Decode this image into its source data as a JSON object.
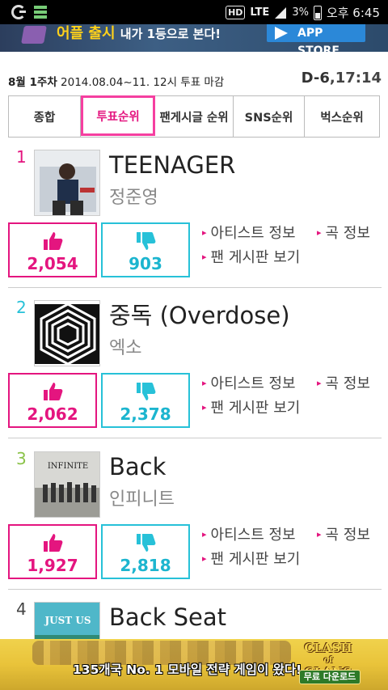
{
  "status_bar": {
    "hd": "HD",
    "network": "LTE",
    "battery_pct": "3%",
    "time": "오후 6:45"
  },
  "ad_top": {
    "headline": "어플 출시",
    "subline": "내가 1등으로 본다!",
    "button": "APP STORE",
    "colors": {
      "headline": "#ffd11a",
      "button": "#2b88d8"
    }
  },
  "header": {
    "week_label": "8월 1주차",
    "period": " 2014.08.04~11. 12시 투표 마감",
    "dday": "D-6",
    "countdown": ",17:14"
  },
  "tabs": [
    {
      "label": "종합",
      "active": false
    },
    {
      "label": "투표순위",
      "active": true
    },
    {
      "label": "팬게시글 순위",
      "active": false
    },
    {
      "label": "SNS순위",
      "active": false
    },
    {
      "label": "벅스순위",
      "active": false
    }
  ],
  "links": {
    "artist_info": "아티스트 정보",
    "song_info": "곡 정보",
    "fan_board": "팬 게시판 보기"
  },
  "chart": [
    {
      "rank": "1",
      "title": "TEENAGER",
      "artist": "정준영",
      "likes": "2,054",
      "dislikes": "903",
      "rank_color": "#e4157f"
    },
    {
      "rank": "2",
      "title": "중독 (Overdose)",
      "artist": "엑소",
      "likes": "2,062",
      "dislikes": "2,378",
      "rank_color": "#27c1d8"
    },
    {
      "rank": "3",
      "title": "Back",
      "artist": "인피니트",
      "likes": "1,927",
      "dislikes": "2,818",
      "rank_color": "#8bc34a"
    },
    {
      "rank": "4",
      "title": "Back Seat",
      "artist": "",
      "likes": "",
      "dislikes": "",
      "rank_color": "#444444"
    }
  ],
  "covers": {
    "infinite_logo": "INFINITE",
    "just_us": "JUST US"
  },
  "ad_bottom": {
    "text": "135개국 No. 1 모바일 전략 게임이 왔다!",
    "logo_line1": "CLASH",
    "logo_line2": "of",
    "logo_line3": "CLANS",
    "button": "무료 다운로드"
  },
  "colors": {
    "accent_pink": "#e4157f",
    "accent_cyan": "#27c1d8"
  }
}
